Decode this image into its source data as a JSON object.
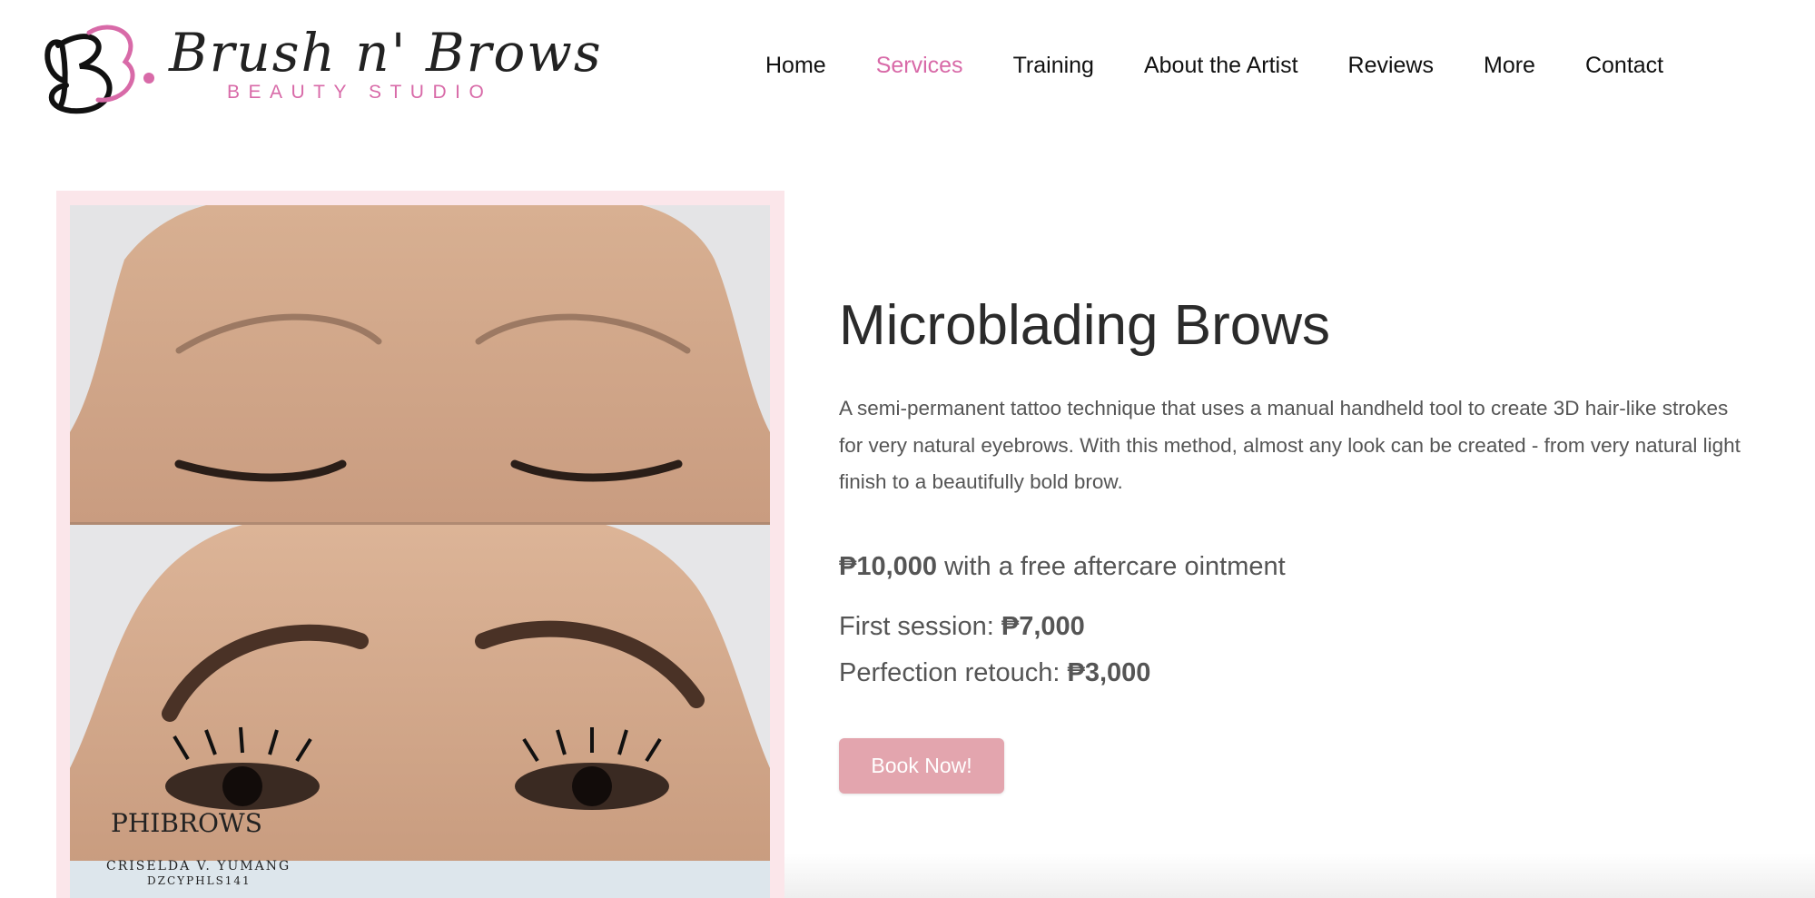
{
  "brand": {
    "name": "Brush n' Brows",
    "tagline": "BEAUTY STUDIO",
    "accent_color": "#d86aa8"
  },
  "nav": {
    "items": [
      {
        "label": "Home",
        "active": false
      },
      {
        "label": "Services",
        "active": true
      },
      {
        "label": "Training",
        "active": false
      },
      {
        "label": "About the Artist",
        "active": false
      },
      {
        "label": "Reviews",
        "active": false
      },
      {
        "label": "More",
        "active": false
      },
      {
        "label": "Contact",
        "active": false
      }
    ]
  },
  "service": {
    "title": "Microblading Brows",
    "description": "A semi-permanent tattoo technique that uses a manual handheld tool to create 3D hair-like strokes for very natural eyebrows. With this method, almost any look can be created - from very natural light finish to a beautifully bold brow.",
    "price": "₱10,000",
    "price_note": " with a free aftercare ointment",
    "first_session_label": "First session: ",
    "first_session_price": "₱7,000",
    "retouch_label": "Perfection retouch: ",
    "retouch_price": "₱3,000",
    "cta_label": "Book Now!",
    "cta_color": "#e3a5ae"
  },
  "photo": {
    "watermark_brand": "PHIBROWS",
    "watermark_artist": "CRISELDA V. YUMANG",
    "watermark_code": "DZCYPHLS141"
  }
}
